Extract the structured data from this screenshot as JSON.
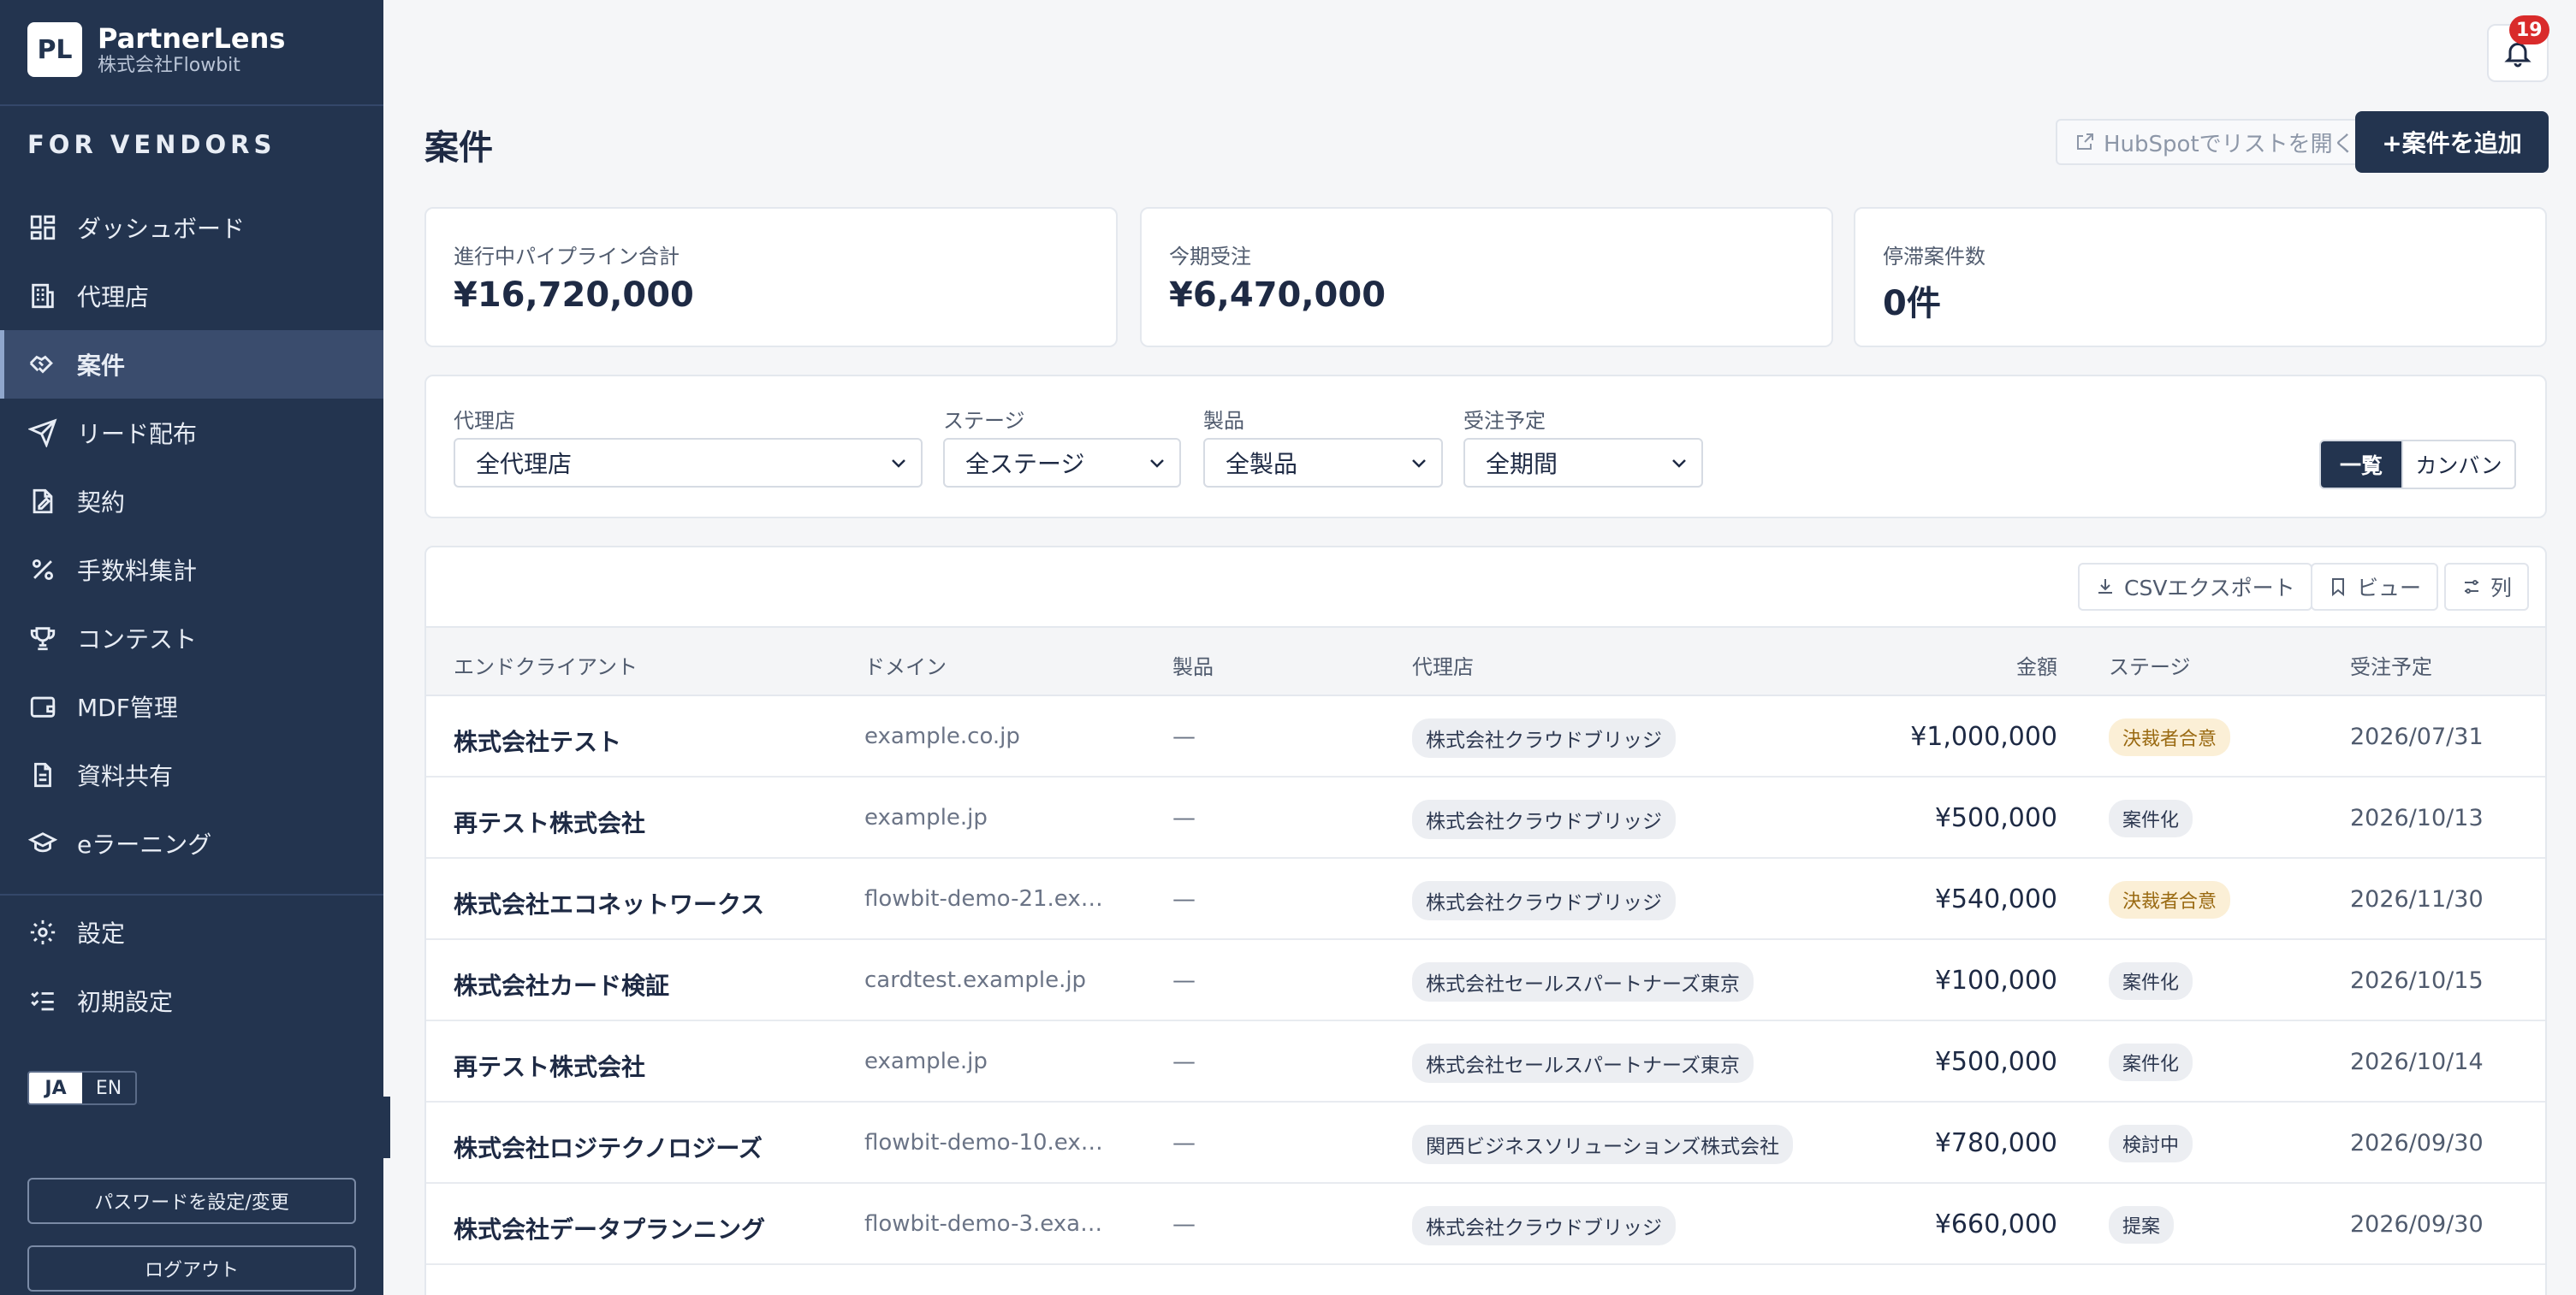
{
  "brand": {
    "logo": "PL",
    "name": "PartnerLens",
    "company": "株式会社Flowbit"
  },
  "sidebar": {
    "section_title": "FOR VENDORS",
    "items": [
      {
        "label": "ダッシュボード",
        "icon": "dashboard-icon"
      },
      {
        "label": "代理店",
        "icon": "building-icon"
      },
      {
        "label": "案件",
        "icon": "handshake-icon",
        "active": true
      },
      {
        "label": "リード配布",
        "icon": "send-icon"
      },
      {
        "label": "契約",
        "icon": "contract-icon"
      },
      {
        "label": "手数料集計",
        "icon": "percent-icon"
      },
      {
        "label": "コンテスト",
        "icon": "trophy-icon"
      },
      {
        "label": "MDF管理",
        "icon": "wallet-icon"
      },
      {
        "label": "資料共有",
        "icon": "document-icon"
      },
      {
        "label": "eラーニング",
        "icon": "graduation-cap-icon"
      }
    ],
    "bottom_items": [
      {
        "label": "設定",
        "icon": "gear-icon"
      },
      {
        "label": "初期設定",
        "icon": "checklist-icon"
      }
    ],
    "lang": {
      "ja": "JA",
      "en": "EN"
    },
    "password_button": "パスワードを設定/変更",
    "logout_button": "ログアウト"
  },
  "header": {
    "notification_count": "19"
  },
  "page": {
    "title": "案件",
    "hubspot_link": "HubSpotでリストを開く",
    "add_button": "+案件を追加"
  },
  "stats": [
    {
      "label": "進行中パイプライン合計",
      "value": "¥16,720,000"
    },
    {
      "label": "今期受注",
      "value": "¥6,470,000"
    },
    {
      "label": "停滞案件数",
      "value": "0件"
    }
  ],
  "filters": {
    "agency": {
      "label": "代理店",
      "value": "全代理店"
    },
    "stage": {
      "label": "ステージ",
      "value": "全ステージ"
    },
    "product": {
      "label": "製品",
      "value": "全製品"
    },
    "expected": {
      "label": "受注予定",
      "value": "全期間"
    },
    "view_list": "一覧",
    "view_kanban": "カンバン"
  },
  "toolbar": {
    "csv": "CSVエクスポート",
    "view": "ビュー",
    "columns": "列"
  },
  "table": {
    "headers": {
      "client": "エンドクライアント",
      "domain": "ドメイン",
      "product": "製品",
      "agency": "代理店",
      "amount": "金額",
      "stage": "ステージ",
      "date": "受注予定"
    },
    "rows": [
      {
        "client": "株式会社テスト",
        "domain": "example.co.jp",
        "product": "—",
        "agency": "株式会社クラウドブリッジ",
        "amount": "¥1,000,000",
        "stage": "決裁者合意",
        "date": "2026/07/31"
      },
      {
        "client": "再テスト株式会社",
        "domain": "example.jp",
        "product": "—",
        "agency": "株式会社クラウドブリッジ",
        "amount": "¥500,000",
        "stage": "案件化",
        "date": "2026/10/13"
      },
      {
        "client": "株式会社エコネットワークス",
        "domain": "flowbit-demo-21.exa…",
        "product": "—",
        "agency": "株式会社クラウドブリッジ",
        "amount": "¥540,000",
        "stage": "決裁者合意",
        "date": "2026/11/30"
      },
      {
        "client": "株式会社カード検証",
        "domain": "cardtest.example.jp",
        "product": "—",
        "agency": "株式会社セールスパートナーズ東京",
        "amount": "¥100,000",
        "stage": "案件化",
        "date": "2026/10/15"
      },
      {
        "client": "再テスト株式会社",
        "domain": "example.jp",
        "product": "—",
        "agency": "株式会社セールスパートナーズ東京",
        "amount": "¥500,000",
        "stage": "案件化",
        "date": "2026/10/14"
      },
      {
        "client": "株式会社ロジテクノロジーズ",
        "domain": "flowbit-demo-10.exa…",
        "product": "—",
        "agency": "関西ビジネスソリューションズ株式会社",
        "amount": "¥780,000",
        "stage": "検討中",
        "date": "2026/09/30"
      },
      {
        "client": "株式会社データプランニング",
        "domain": "flowbit-demo-3.exam…",
        "product": "—",
        "agency": "株式会社クラウドブリッジ",
        "amount": "¥660,000",
        "stage": "提案",
        "date": "2026/09/30"
      }
    ]
  }
}
